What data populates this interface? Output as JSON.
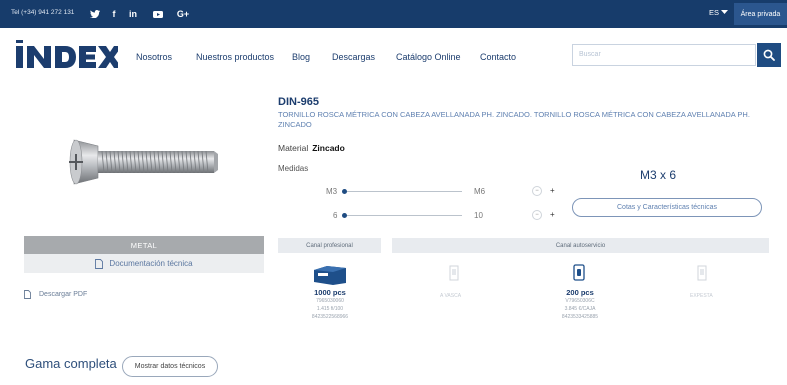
{
  "topbar": {
    "phone": "Tel (+34) 941 272 131",
    "social_twitter": "",
    "social_facebook": "f",
    "social_linkedin": "in",
    "social_youtube": "",
    "social_googleplus": "G+",
    "language": "ES",
    "private_area": "Área privada"
  },
  "header": {
    "logo_text": "INDEX",
    "nav": [
      "Nosotros",
      "Nuestros productos",
      "Blog",
      "Descargas",
      "Catálogo Online",
      "Contacto"
    ],
    "search_placeholder": "Buscar"
  },
  "product": {
    "code": "DIN-965",
    "description": "TORNILLO ROSCA MÉTRICA CON CABEZA AVELLANADA PH. ZINCADO. TORNILLO ROSCA MÉTRICA CON CABEZA AVELLANADA PH. ZINCADO",
    "material_label": "Material",
    "material_value": "Zincado",
    "measures_label": "Medidas",
    "selected_size": "M3 x 6",
    "slider1": {
      "min": "M3",
      "max": "M6"
    },
    "slider2": {
      "min": "6",
      "max": "10"
    },
    "cotas_button": "Cotas y Características técnicas",
    "metal_label": "METAL",
    "doc_label": "Documentación técnica",
    "pdf_label": "Descargar PDF"
  },
  "channels": {
    "professional": "Canal profesional",
    "self_service": "Canal autoservicio",
    "packs": [
      {
        "pcs": "1000 pcs",
        "lines": [
          "7965030060",
          "1.415 fi/100",
          "8423522568966"
        ]
      },
      {
        "pcs": "200 pcs",
        "lines": [
          "V79650306C",
          "3.845 €/CAJA",
          "8423533425885"
        ]
      }
    ],
    "faint1": "A VASCA",
    "faint2": "EXPESTA"
  },
  "bottom": {
    "gama": "Gama completa",
    "show_button": "Mostrar datos técnicos"
  },
  "colors": {
    "topbar": "#173c6b",
    "accent": "#1f4c82",
    "metal_bar": "#a7aaad"
  }
}
